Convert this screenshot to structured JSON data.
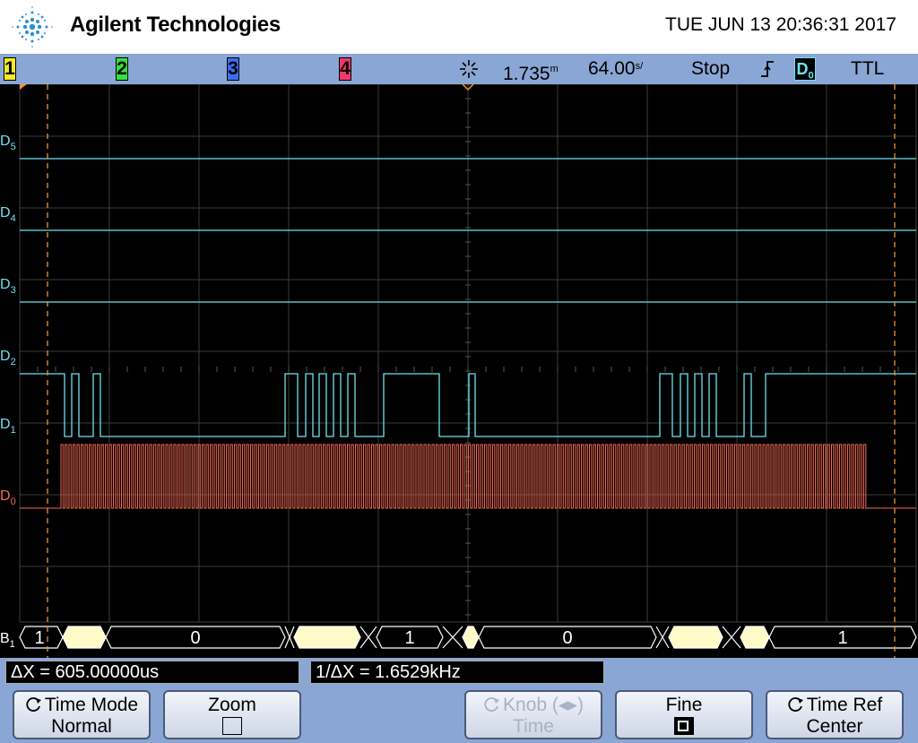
{
  "header": {
    "brand": "Agilent Technologies",
    "datetime": "TUE JUN 13 20:36:31 2017"
  },
  "status": {
    "channels": [
      {
        "label": "1",
        "color": "#f2ea28"
      },
      {
        "label": "2",
        "color": "#33e33a"
      },
      {
        "label": "3",
        "color": "#3a6df2"
      },
      {
        "label": "4",
        "color": "#f0386b"
      }
    ],
    "delay": "1.735",
    "delay_unit": "m",
    "timebase": "64.00",
    "timebase_unit": "s/",
    "run_state": "Stop",
    "trigger_source": "D",
    "trigger_source_sub": "0",
    "threshold": "TTL"
  },
  "scope": {
    "digital_color": "#6de3ee",
    "d0_color": "#f26a55",
    "grid_color": "#3c3c3c",
    "cursor_color": "#f0902e",
    "bus_fill": "#fffbc8",
    "channel_labels": [
      {
        "id": "d5",
        "text": "D",
        "sub": "5"
      },
      {
        "id": "d4",
        "text": "D",
        "sub": "4"
      },
      {
        "id": "d3",
        "text": "D",
        "sub": "3"
      },
      {
        "id": "d2",
        "text": "D",
        "sub": "2"
      },
      {
        "id": "d1",
        "text": "D",
        "sub": "1"
      },
      {
        "id": "d0",
        "text": "D",
        "sub": "0"
      }
    ],
    "bus_label": "B",
    "bus_label_sub": "1",
    "bus_values": [
      "1",
      "0",
      "1",
      "0",
      "1"
    ]
  },
  "measurements": {
    "delta_x": "ΔX = 605.00000us",
    "inv_delta_x": "1/ΔX = 1.6529kHz"
  },
  "softkeys": [
    {
      "id": "time-mode",
      "line1": "Time Mode",
      "line2": "Normal",
      "icon": "rotate-icon",
      "enabled": true
    },
    {
      "id": "zoom",
      "line1": "Zoom",
      "line2": "",
      "icon": "checkbox-empty-icon",
      "enabled": true
    },
    {
      "id": "knob",
      "line1": "Knob (◂▸)",
      "line2": "Time",
      "icon": "rotate-icon",
      "enabled": false
    },
    {
      "id": "fine",
      "line1": "Fine",
      "line2": "",
      "icon": "checkbox-checked-icon",
      "enabled": true
    },
    {
      "id": "time-ref",
      "line1": "Time Ref",
      "line2": "Center",
      "icon": "rotate-icon",
      "enabled": true
    }
  ]
}
